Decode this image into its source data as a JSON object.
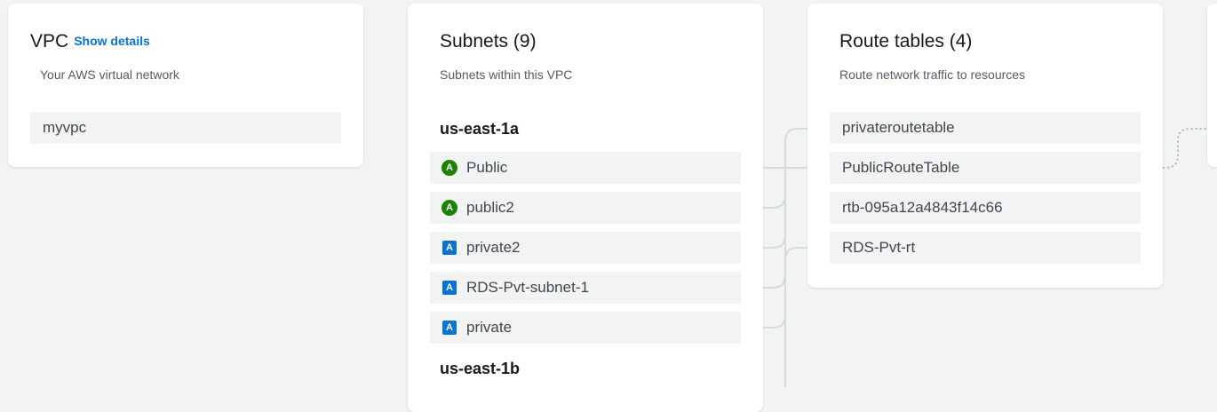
{
  "vpc": {
    "title": "VPC",
    "show_details": "Show details",
    "subtitle": "Your AWS virtual network",
    "name": "myvpc"
  },
  "subnets": {
    "title": "Subnets (9)",
    "subtitle": "Subnets within this VPC",
    "zones": [
      {
        "name": "us-east-1a",
        "items": [
          {
            "label": "Public",
            "badge": "A",
            "type": "public"
          },
          {
            "label": "public2",
            "badge": "A",
            "type": "public"
          },
          {
            "label": "private2",
            "badge": "A",
            "type": "private"
          },
          {
            "label": "RDS-Pvt-subnet-1",
            "badge": "A",
            "type": "private"
          },
          {
            "label": "private",
            "badge": "A",
            "type": "private"
          }
        ]
      },
      {
        "name": "us-east-1b",
        "items": []
      }
    ]
  },
  "route_tables": {
    "title": "Route tables (4)",
    "subtitle": "Route network traffic to resources",
    "items": [
      {
        "label": "privateroutetable"
      },
      {
        "label": "PublicRouteTable"
      },
      {
        "label": "rtb-095a12a4843f14c66"
      },
      {
        "label": "RDS-Pvt-rt"
      }
    ]
  },
  "colors": {
    "page_bg": "#f2f3f3",
    "connector": "#d5dbdb",
    "public_badge": "#1d8102",
    "private_badge": "#0972d3",
    "link": "#0972d3"
  }
}
